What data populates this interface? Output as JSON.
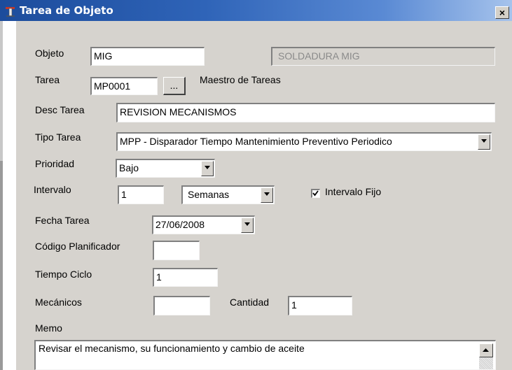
{
  "window": {
    "title": "Tarea de Objeto",
    "close_symbol": "×"
  },
  "icons": {
    "title": "tool-icon",
    "close": "close-icon",
    "dropdown": "chevron-down-icon",
    "check": "checkmark-icon"
  },
  "form": {
    "objeto": {
      "label": "Objeto",
      "value": "MIG",
      "description": "SOLDADURA MIG"
    },
    "tarea": {
      "label": "Tarea",
      "value": "MP0001",
      "browse_label": "...",
      "maestro_label": "Maestro de Tareas"
    },
    "desc_tarea": {
      "label": "Desc Tarea",
      "value": "REVISION MECANISMOS"
    },
    "tipo_tarea": {
      "label": "Tipo Tarea",
      "value": "MPP - Disparador Tiempo Mantenimiento Preventivo Periodico"
    },
    "prioridad": {
      "label": "Prioridad",
      "value": "Bajo"
    },
    "intervalo": {
      "label": "Intervalo",
      "value": "1",
      "unit": "Semanas",
      "fijo_label": "Intervalo Fijo",
      "fijo_checked": true
    },
    "fecha_tarea": {
      "label": "Fecha Tarea",
      "value": "27/06/2008"
    },
    "codigo_planificador": {
      "label": "Código Planificador",
      "value": ""
    },
    "tiempo_ciclo": {
      "label": "Tiempo Ciclo",
      "value": "1"
    },
    "mecanicos": {
      "label": "Mecánicos",
      "value": ""
    },
    "cantidad": {
      "label": "Cantidad",
      "value": "1"
    },
    "memo": {
      "label": "Memo",
      "value": "Revisar el mecanismo, su funcionamiento y cambio de aceite"
    }
  }
}
